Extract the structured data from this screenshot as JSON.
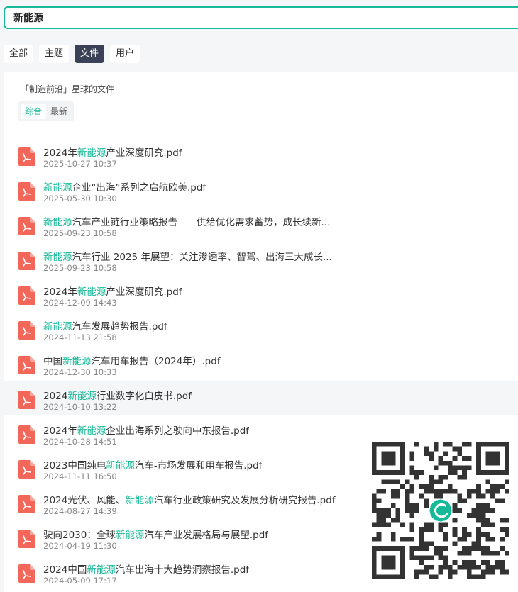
{
  "search": {
    "value": "新能源"
  },
  "tabs": [
    {
      "label": "全部",
      "active": false
    },
    {
      "label": "主题",
      "active": false
    },
    {
      "label": "文件",
      "active": true
    },
    {
      "label": "用户",
      "active": false
    }
  ],
  "panel": {
    "group_title": "「制造前沿」星球的文件",
    "subtabs": [
      {
        "label": "综合",
        "active": true
      },
      {
        "label": "最新",
        "active": false
      }
    ]
  },
  "files": [
    {
      "pre": "2024年",
      "kw": "新能源",
      "post": "产业深度研究.pdf",
      "date": "2025-10-27 10:37"
    },
    {
      "pre": "",
      "kw": "新能源",
      "post": "企业“出海”系列之启航欧美.pdf",
      "date": "2025-05-30 10:30"
    },
    {
      "pre": "",
      "kw": "新能源",
      "post": "汽车产业链行业策略报告——供给优化需求蓄势，成长续新...",
      "date": "2025-09-23 10:58"
    },
    {
      "pre": "",
      "kw": "新能源",
      "post": "汽车行业 2025 年展望：关注渗透率、智驾、出海三大成长...",
      "date": "2025-09-23 10:58"
    },
    {
      "pre": "2024年",
      "kw": "新能源",
      "post": "产业深度研究.pdf",
      "date": "2024-12-09 14:43"
    },
    {
      "pre": "",
      "kw": "新能源",
      "post": "汽车发展趋势报告.pdf",
      "date": "2024-11-13 21:58"
    },
    {
      "pre": "中国",
      "kw": "新能源",
      "post": "汽车用车报告（2024年）.pdf",
      "date": "2024-12-30 10:33"
    },
    {
      "pre": "2024",
      "kw": "新能源",
      "post": "行业数字化白皮书.pdf",
      "date": "2024-10-10 13:22"
    },
    {
      "pre": "2024年",
      "kw": "新能源",
      "post": "企业出海系列之驶向中东报告.pdf",
      "date": "2024-10-28 14:51"
    },
    {
      "pre": "2023中国纯电",
      "kw": "新能源",
      "post": "汽车-市场发展和用车报告.pdf",
      "date": "2024-11-11 16:50"
    },
    {
      "pre": "2024光伏、风能、",
      "kw": "新能源",
      "post": "汽车行业政策研究及发展分析研究报告.pdf",
      "date": "2024-08-27 14:39"
    },
    {
      "pre": "驶向2030：全球",
      "kw": "新能源",
      "post": "汽车产业发展格局与展望.pdf",
      "date": "2024-04-19 11:30"
    },
    {
      "pre": "2024中国",
      "kw": "新能源",
      "post": "汽车出海十大趋势洞察报告.pdf",
      "date": "2024-05-09 17:17"
    }
  ],
  "hover_index": 7,
  "icons": {
    "file": "pdf-file-icon",
    "qr": "qr-code-icon"
  },
  "colors": {
    "accent": "#16b998",
    "pdf_red": "#f2675a",
    "active_tab": "#3b4156"
  }
}
